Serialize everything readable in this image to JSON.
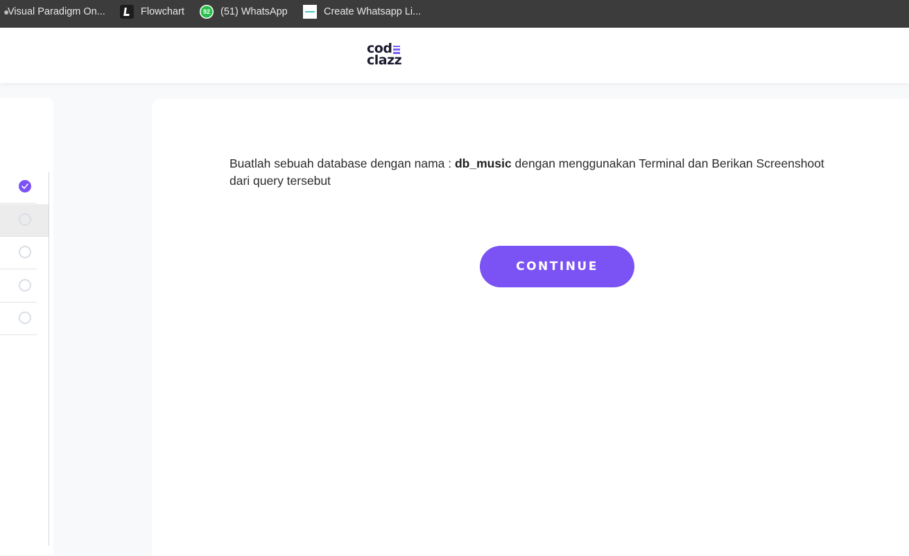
{
  "bookmarks": [
    {
      "label": "Visual Paradigm On...",
      "icon": "visual-paradigm-icon"
    },
    {
      "label": "Flowchart",
      "icon": "flowchart-icon"
    },
    {
      "label": "(51) WhatsApp",
      "icon": "whatsapp-icon",
      "badge": "92"
    },
    {
      "label": "Create Whatsapp Li...",
      "icon": "generator-site-icon"
    }
  ],
  "header": {
    "logo_line1": "cod",
    "logo_line2": "clazz",
    "logo_accent_color": "#7b5cf6"
  },
  "steps": [
    {
      "status": "completed"
    },
    {
      "status": "current"
    },
    {
      "status": "pending"
    },
    {
      "status": "pending"
    },
    {
      "status": "pending"
    }
  ],
  "question": {
    "text_before": "Buatlah sebuah database dengan nama : ",
    "db_name": "db_music",
    "text_after": " dengan menggunakan Terminal dan Berikan Screenshoot dari query tersebut"
  },
  "continue_label": "CONTINUE",
  "colors": {
    "accent": "#7b52f4",
    "bookmarks_bar": "#3c3c3c"
  }
}
